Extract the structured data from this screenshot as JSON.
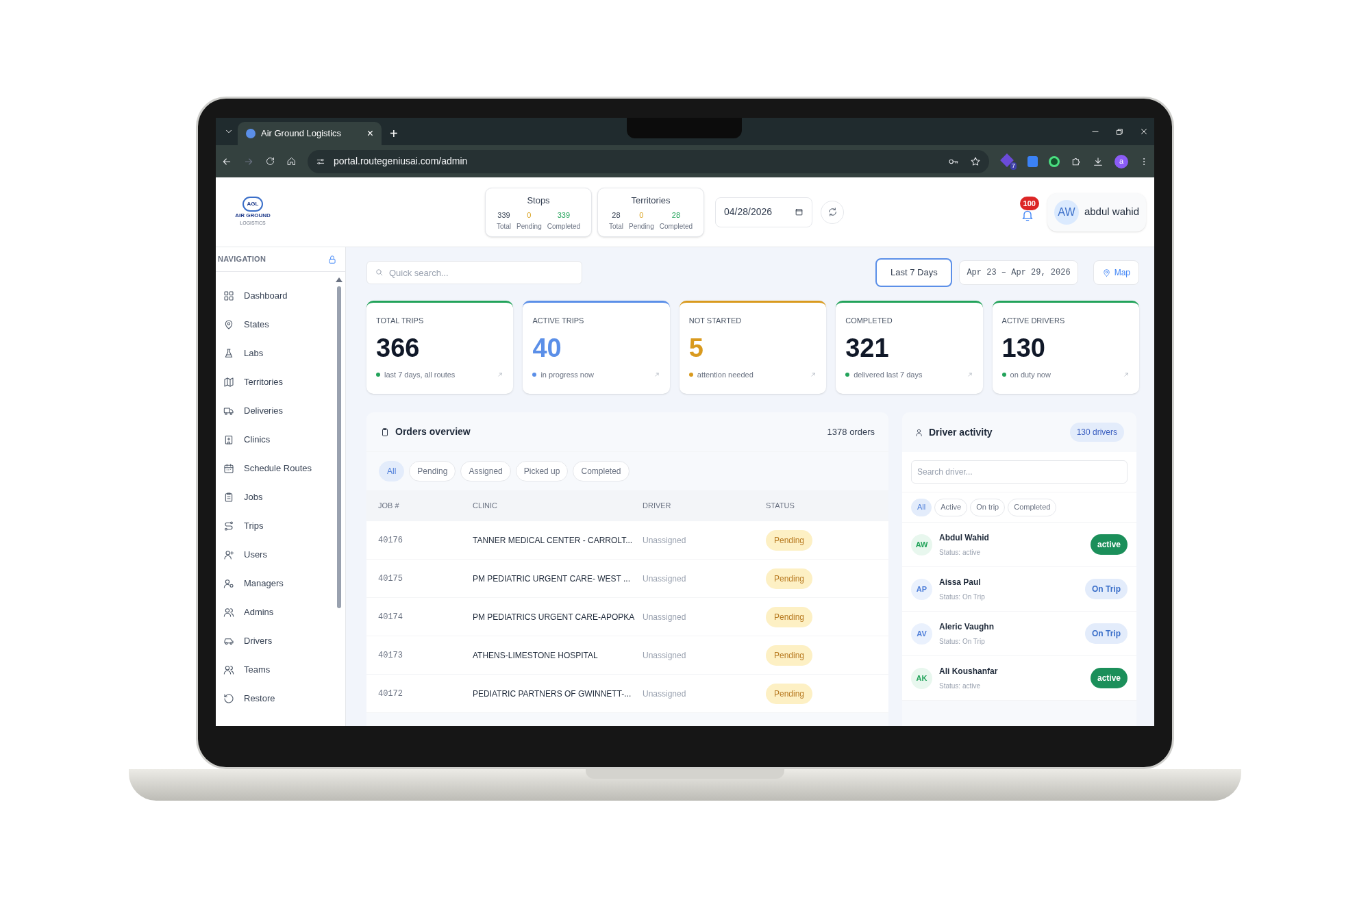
{
  "browser": {
    "tabs": [
      {
        "title": "Air Ground Logistics",
        "selected": true,
        "close": "×"
      }
    ],
    "new_tab": "+",
    "url": "portal.routegeniusai.com/admin",
    "extension_badge": "7",
    "profile_initial": "a"
  },
  "logo": {
    "mark": "AGL",
    "name": "AIR GROUND",
    "tagline": "LOGISTICS"
  },
  "summaries": [
    {
      "title": "Stops",
      "stats": [
        {
          "value": "339",
          "label": "Total",
          "kind": "total"
        },
        {
          "value": "0",
          "label": "Pending",
          "kind": "pending"
        },
        {
          "value": "339",
          "label": "Completed",
          "kind": "completed"
        }
      ]
    },
    {
      "title": "Territories",
      "stats": [
        {
          "value": "28",
          "label": "Total",
          "kind": "total"
        },
        {
          "value": "0",
          "label": "Pending",
          "kind": "pending"
        },
        {
          "value": "28",
          "label": "Completed",
          "kind": "completed"
        }
      ]
    }
  ],
  "date": "04/28/2026",
  "notifications": "100",
  "user": {
    "initials": "AW",
    "name": "abdul wahid"
  },
  "sidebar": {
    "heading": "NAVIGATION",
    "items": [
      "Dashboard",
      "States",
      "Labs",
      "Territories",
      "Deliveries",
      "Clinics",
      "Schedule Routes",
      "Jobs",
      "Trips",
      "Users",
      "Managers",
      "Admins",
      "Drivers",
      "Teams",
      "Restore"
    ]
  },
  "toolbar": {
    "search": {
      "placeholder": "Quick search..."
    },
    "range": {
      "label": "Last 7 Days",
      "selected": true
    },
    "dates": "Apr 23 – Apr 29, 2026",
    "map": "Map"
  },
  "stats": [
    {
      "label": "TOTAL TRIPS",
      "value": "366",
      "note": "last 7 days, all routes",
      "color": "#22a35a",
      "highlighted": false
    },
    {
      "label": "ACTIVE TRIPS",
      "value": "40",
      "note": "in progress now",
      "color": "#5b8fe8",
      "highlighted": true
    },
    {
      "label": "NOT STARTED",
      "value": "5",
      "note": "attention needed",
      "color": "#d99a1e",
      "highlighted": true
    },
    {
      "label": "COMPLETED",
      "value": "321",
      "note": "delivered last 7 days",
      "color": "#22a35a",
      "highlighted": false
    },
    {
      "label": "ACTIVE DRIVERS",
      "value": "130",
      "note": "on duty now",
      "color": "#22a35a",
      "highlighted": false
    }
  ],
  "orders": {
    "title": "Orders overview",
    "count": "1378 orders",
    "filters": [
      {
        "label": "All",
        "selected": true
      },
      {
        "label": "Pending",
        "selected": false
      },
      {
        "label": "Assigned",
        "selected": false
      },
      {
        "label": "Picked up",
        "selected": false
      },
      {
        "label": "Completed",
        "selected": false
      }
    ],
    "columns": [
      "JOB #",
      "CLINIC",
      "DRIVER",
      "STATUS"
    ],
    "rows": [
      {
        "job": "40176",
        "clinic": "TANNER MEDICAL CENTER - CARROLT...",
        "driver": "Unassigned",
        "status": "Pending",
        "kind": "pending"
      },
      {
        "job": "40175",
        "clinic": "PM PEDIATRIC URGENT CARE- WEST ...",
        "driver": "Unassigned",
        "status": "Pending",
        "kind": "pending"
      },
      {
        "job": "40174",
        "clinic": "PM PEDIATRICS URGENT CARE-APOPKA",
        "driver": "Unassigned",
        "status": "Pending",
        "kind": "pending"
      },
      {
        "job": "40173",
        "clinic": "ATHENS-LIMESTONE HOSPITAL",
        "driver": "Unassigned",
        "status": "Pending",
        "kind": "pending"
      },
      {
        "job": "40172",
        "clinic": "PEDIATRIC PARTNERS OF GWINNETT-...",
        "driver": "Unassigned",
        "status": "Pending",
        "kind": "pending"
      }
    ]
  },
  "drivers": {
    "title": "Driver activity",
    "count": "130 drivers",
    "search": {
      "placeholder": "Search driver..."
    },
    "filters": [
      {
        "label": "All",
        "selected": true
      },
      {
        "label": "Active",
        "selected": false
      },
      {
        "label": "On trip",
        "selected": false
      },
      {
        "label": "Completed",
        "selected": false
      }
    ],
    "list": [
      {
        "initials": "AW",
        "name": "Abdul Wahid",
        "status_line": "Status: active",
        "badge": "active",
        "kind": "active"
      },
      {
        "initials": "AP",
        "name": "Aissa Paul",
        "status_line": "Status: On Trip",
        "badge": "On Trip",
        "kind": "on_trip"
      },
      {
        "initials": "AV",
        "name": "Aleric Vaughn",
        "status_line": "Status: On Trip",
        "badge": "On Trip",
        "kind": "on_trip"
      },
      {
        "initials": "AK",
        "name": "Ali Koushanfar",
        "status_line": "Status: active",
        "badge": "active",
        "kind": "active"
      }
    ]
  }
}
